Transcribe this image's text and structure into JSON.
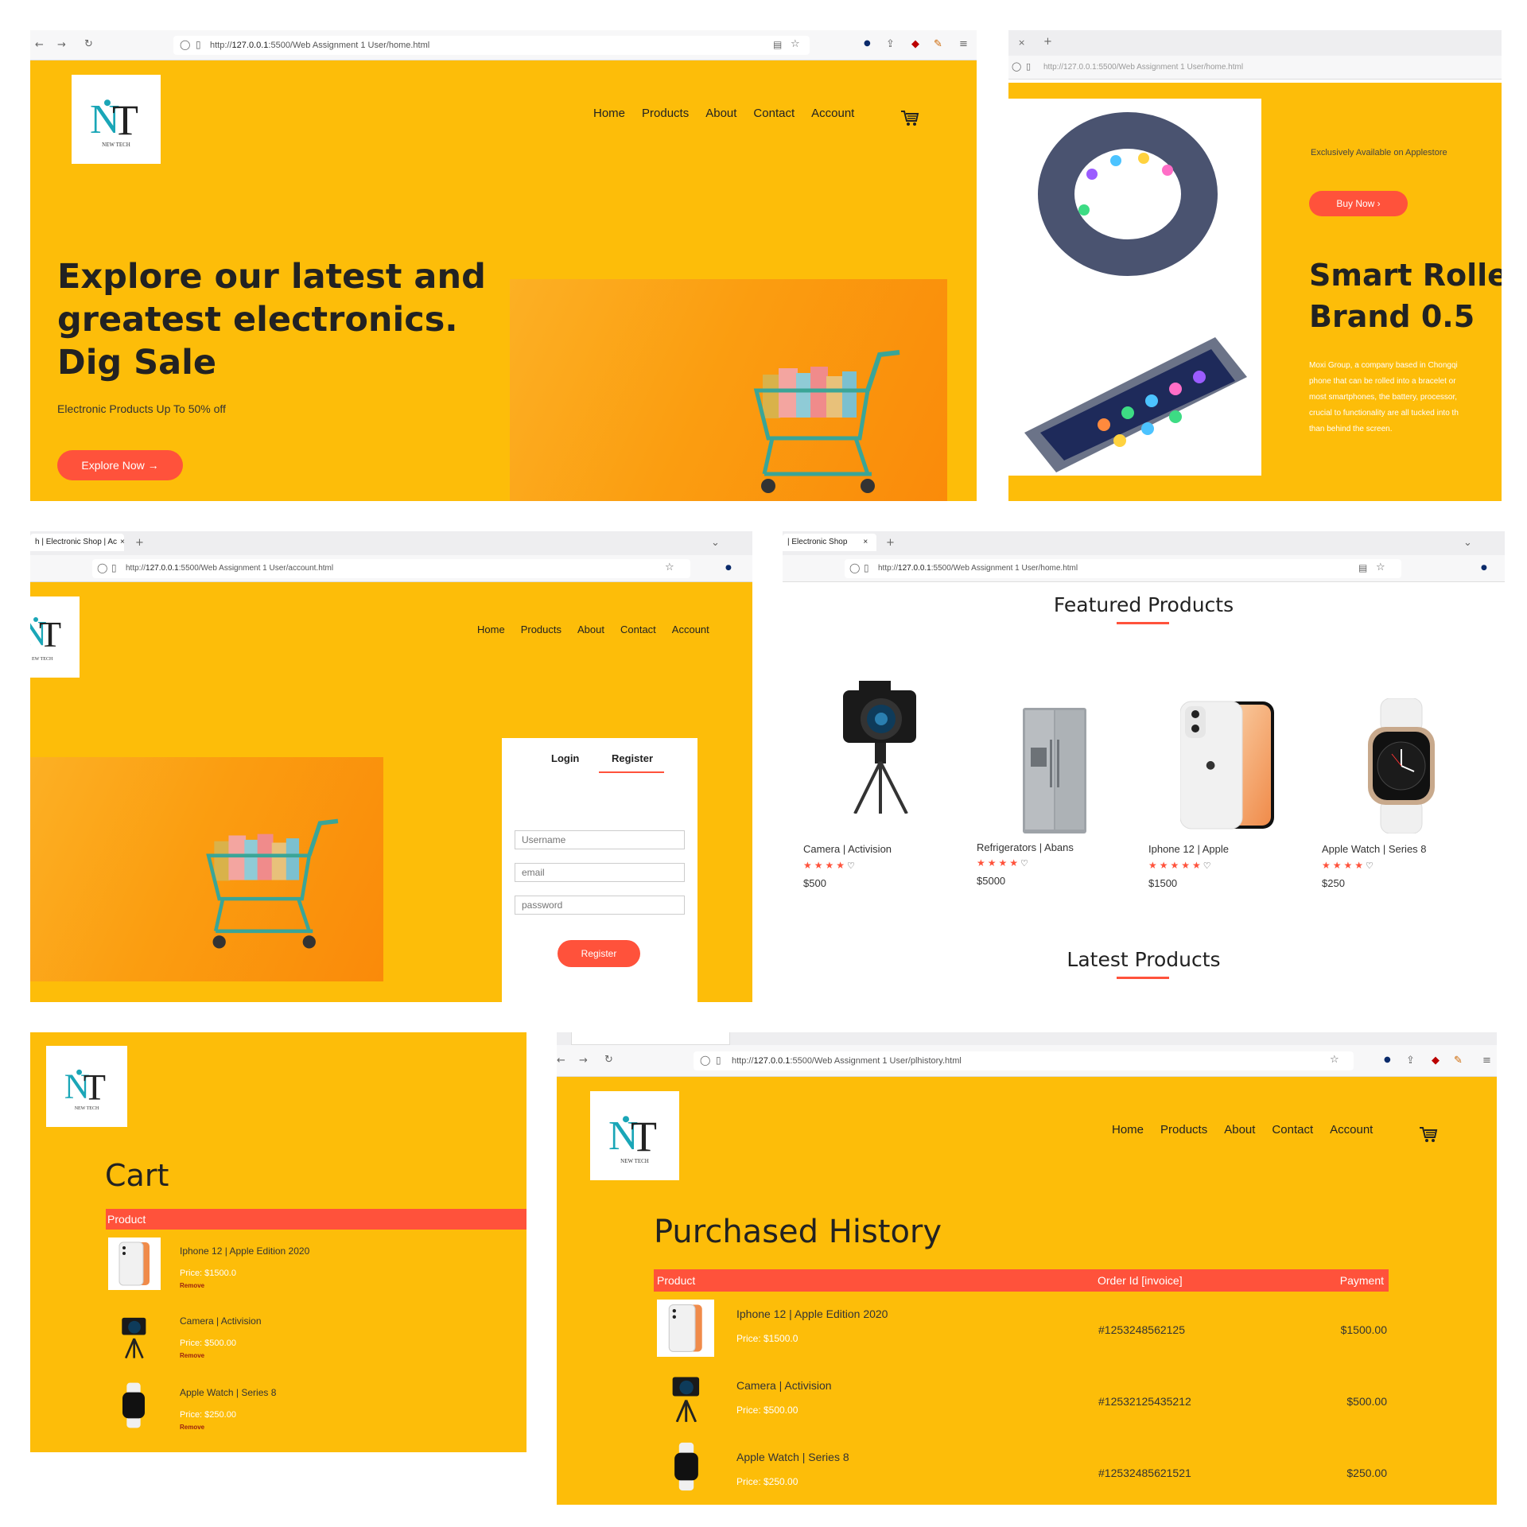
{
  "colors": {
    "brand_yellow": "#fdbd09",
    "accent_red": "#ff523b",
    "teal": "#1aa6b7"
  },
  "logo": {
    "initials": "NT",
    "tagline": "NEW TECH"
  },
  "nav": {
    "home": "Home",
    "products": "Products",
    "about": "About",
    "contact": "Contact",
    "account": "Account"
  },
  "home_page": {
    "url_prefix": "http://",
    "url_host": "127.0.0.1",
    "url_path": ":5500/Web Assignment 1 User/home.html",
    "heading_line1": "Explore our latest and",
    "heading_line2": "greatest electronics.",
    "heading_line3": "Dig Sale",
    "subtitle": "Electronic Products Up To 50% off",
    "button": "Explore Now →"
  },
  "promo_page": {
    "url": "http://127.0.0.1:5500/Web Assignment 1 User/home.html",
    "eyebrow": "Exclusively Available on Applestore",
    "button": "Buy Now  ›",
    "title_line1": "Smart Roller",
    "title_line2": "Brand 0.5",
    "desc_lines": [
      "Moxi Group, a company based in Chongqi",
      "phone that can be rolled into a bracelet or",
      "most smartphones, the battery, processor,",
      "crucial to functionality are all tucked into th",
      "than behind the screen."
    ]
  },
  "account_page": {
    "tab_title": "h | Electronic Shop | Ac",
    "url_prefix": "http://",
    "url_host": "127.0.0.1",
    "url_path": ":5500/Web Assignment 1 User/account.html",
    "tab_login": "Login",
    "tab_register": "Register",
    "username_placeholder": "Username",
    "email_placeholder": "email",
    "password_placeholder": "password",
    "register_button": "Register"
  },
  "featured_page": {
    "tab_title": "| Electronic Shop",
    "url_prefix": "http://",
    "url_host": "127.0.0.1",
    "url_path": ":5500/Web Assignment 1 User/home.html",
    "featured_title": "Featured Products",
    "latest_title": "Latest Products",
    "products": [
      {
        "name": "Camera | Activision",
        "price": "$500",
        "stars": "★★★★",
        "icon": "camera"
      },
      {
        "name": "Refrigerators | Abans",
        "price": "$5000",
        "stars": "★★★★",
        "icon": "fridge"
      },
      {
        "name": "Iphone 12 | Apple",
        "price": "$1500",
        "stars": "★★★★★",
        "icon": "phone"
      },
      {
        "name": "Apple Watch | Series 8",
        "price": "$250",
        "stars": "★★★★",
        "icon": "watch"
      }
    ]
  },
  "cart_page": {
    "title": "Cart",
    "col_product": "Product",
    "items": [
      {
        "name": "Iphone 12 | Apple Edition 2020",
        "price": "Price: $1500.0",
        "remove": "Remove"
      },
      {
        "name": "Camera | Activision",
        "price": "Price: $500.00",
        "remove": "Remove"
      },
      {
        "name": "Apple Watch | Series 8",
        "price": "Price: $250.00",
        "remove": "Remove"
      }
    ]
  },
  "history_page": {
    "url_prefix": "http://",
    "url_host": "127.0.0.1",
    "url_path": ":5500/Web Assignment 1 User/plhistory.html",
    "title": "Purchased History",
    "col_product": "Product",
    "col_order": "Order Id [invoice]",
    "col_payment": "Payment",
    "rows": [
      {
        "name": "Iphone 12 | Apple Edition 2020",
        "price": "Price: $1500.0",
        "order": "#1253248562125",
        "payment": "$1500.00"
      },
      {
        "name": "Camera | Activision",
        "price": "Price: $500.00",
        "order": "#12532125435212",
        "payment": "$500.00"
      },
      {
        "name": "Apple Watch | Series 8",
        "price": "Price: $250.00",
        "order": "#12532485621521",
        "payment": "$250.00"
      }
    ]
  }
}
